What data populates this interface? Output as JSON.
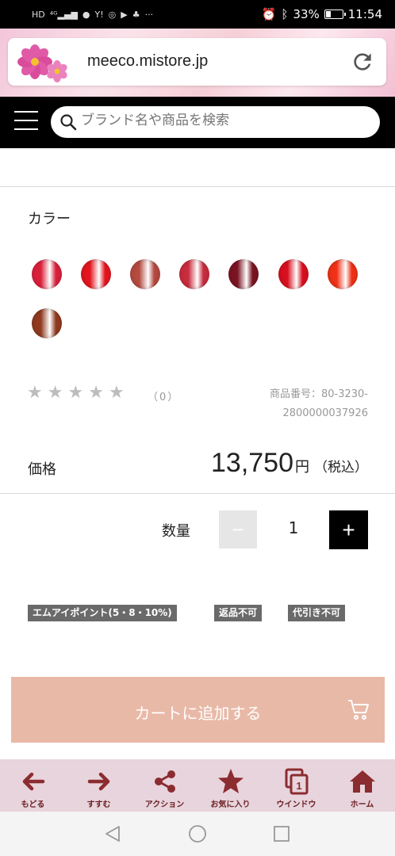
{
  "status_bar": {
    "left_icons": [
      "hd-icon",
      "4g-signal-icon",
      "line-icon",
      "yahoo-icon",
      "wifi-icon",
      "play-store-icon",
      "android-icon",
      "more-icon"
    ],
    "battery_percent": "33%",
    "battery_level": 0.33,
    "time": "11:54"
  },
  "browser": {
    "url": "meeco.mistore.jp"
  },
  "header": {
    "search_placeholder": "ブランド名や商品を検索"
  },
  "product": {
    "color_heading": "カラー",
    "color_swatches": [
      "#d9203b",
      "#e3151f",
      "#b44a40",
      "#c82c3e",
      "#7a1422",
      "#d80f1e",
      "#ef3117",
      "#8f3a1f"
    ],
    "rating_stars": 5,
    "review_count": "（0）",
    "product_code_line1": "商品番号：80-3230-",
    "product_code_line2": "2800000037926",
    "price_label": "価格",
    "price_value": "13,750",
    "price_unit": "円",
    "price_tax": "（税込）",
    "quantity_label": "数量",
    "quantity_minus": "−",
    "quantity_value": "1",
    "quantity_plus": "+",
    "tags": [
      "エムアイポイント(5・8・10%)",
      "返品不可",
      "代引き不可"
    ],
    "cart_button_label": "カートに追加する"
  },
  "toolbar": {
    "accent_color": "#8b2c30",
    "items": [
      {
        "label": "もどる",
        "icon": "back-arrow-icon"
      },
      {
        "label": "すすむ",
        "icon": "forward-arrow-icon"
      },
      {
        "label": "アクション",
        "icon": "share-icon"
      },
      {
        "label": "お気に入り",
        "icon": "star-icon"
      },
      {
        "label": "ウインドウ",
        "icon": "window-icon",
        "badge": "1"
      },
      {
        "label": "ホーム",
        "icon": "home-icon"
      }
    ]
  }
}
